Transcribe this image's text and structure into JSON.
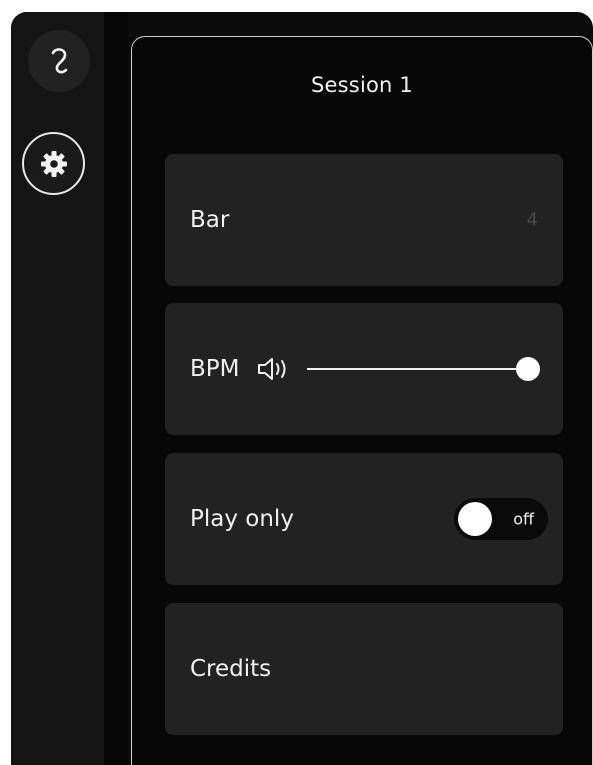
{
  "panel": {
    "title": "Session 1"
  },
  "settings": {
    "bar": {
      "label": "Bar",
      "value": "4"
    },
    "bpm": {
      "label": "BPM",
      "icon": "speaker-volume-icon",
      "volume_fraction": 0.97
    },
    "play_only": {
      "label": "Play only",
      "state": "off"
    },
    "credits": {
      "label": "Credits"
    }
  },
  "sidebar": {
    "logo_icon": "logo-glyph-icon",
    "settings_icon": "gear-icon"
  }
}
